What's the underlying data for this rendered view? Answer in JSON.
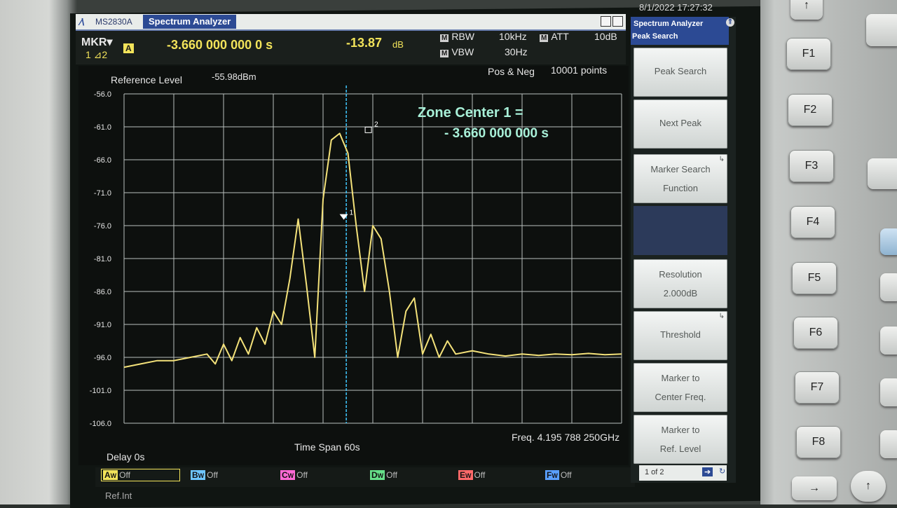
{
  "window": {
    "model": "MS2830A",
    "app_title": "Spectrum Analyzer",
    "datetime": "8/1/2022 17:27:32"
  },
  "marker": {
    "label": "MKR",
    "sub_label": "1 ⊿2",
    "badge": "A",
    "value_time": "-3.660 000 000 0 s",
    "value_db": "-13.87",
    "db_unit": "dB"
  },
  "settings": {
    "rbw_label": "RBW",
    "rbw_value": "10kHz",
    "vbw_label": "VBW",
    "vbw_value": "30Hz",
    "att_label": "ATT",
    "att_value": "10dB",
    "m_badge": "M"
  },
  "graph": {
    "reference_level_label": "Reference Level",
    "reference_level_value": "-55.98dBm",
    "detection": "Pos & Neg",
    "points": "10001 points",
    "zone_center_line1": "Zone Center 1 =",
    "zone_center_line2": "- 3.660 000 000 s",
    "marker1_label": "1",
    "marker2_label": "2",
    "delay": "Delay 0s",
    "time_span": "Time Span 60s",
    "frequency": "Freq. 4.195 788 250GHz"
  },
  "chart_data": {
    "type": "line",
    "ylabel": "",
    "xlabel": "",
    "y_ticks": [
      "-56.0",
      "-61.0",
      "-66.0",
      "-71.0",
      "-76.0",
      "-81.0",
      "-86.0",
      "-91.0",
      "-96.0",
      "-101.0",
      "-106.0"
    ],
    "ylim": [
      -106.0,
      -56.0
    ],
    "xlim": [
      0,
      60
    ],
    "grid": true,
    "trace_color": "#f4e27a",
    "series": [
      {
        "x": [
          0,
          2,
          4,
          6,
          8,
          10,
          11,
          12,
          13,
          14,
          15,
          16,
          17,
          18,
          19,
          20,
          21,
          22,
          23,
          24,
          25,
          26,
          27,
          28,
          29,
          30,
          31,
          32,
          33,
          34,
          35,
          36,
          37,
          38,
          39,
          40,
          42,
          44,
          46,
          48,
          50,
          52,
          54,
          56,
          58,
          60
        ],
        "y": [
          -97.5,
          -97.0,
          -96.5,
          -96.5,
          -96.0,
          -95.5,
          -97.0,
          -94.0,
          -96.5,
          -93.0,
          -95.5,
          -91.5,
          -94.0,
          -89.0,
          -91.0,
          -84.0,
          -75.0,
          -85.0,
          -96.0,
          -72.0,
          -63.0,
          -62.0,
          -65.0,
          -76.0,
          -86.0,
          -76.0,
          -78.0,
          -86.0,
          -96.0,
          -89.0,
          -87.0,
          -95.5,
          -92.5,
          -96.0,
          -93.5,
          -95.5,
          -95.0,
          -95.5,
          -95.8,
          -95.5,
          -95.7,
          -95.5,
          -95.6,
          -95.4,
          -95.6,
          -95.5
        ]
      }
    ],
    "marker_lines": [
      {
        "x": 26.8
      }
    ]
  },
  "softkeys": {
    "header_app": "Spectrum Analyzer",
    "header_func": "Peak Search",
    "items": [
      {
        "line1": "Peak Search",
        "line2": ""
      },
      {
        "line1": "Next Peak",
        "line2": ""
      },
      {
        "line1": "Marker Search",
        "line2": "Function"
      },
      {
        "line1": "Resolution",
        "line2": "2.000dB"
      },
      {
        "line1": "Threshold",
        "line2": ""
      },
      {
        "line1": "Marker to",
        "line2": "Center Freq."
      },
      {
        "line1": "Marker to",
        "line2": "Ref. Level"
      }
    ],
    "page": "1 of 2"
  },
  "traces": [
    {
      "id": "A",
      "letter": "W",
      "state": "Off",
      "color": "#f2e35a"
    },
    {
      "id": "B",
      "letter": "W",
      "state": "Off",
      "color": "#6fc6ff"
    },
    {
      "id": "C",
      "letter": "W",
      "state": "Off",
      "color": "#ff6ad5"
    },
    {
      "id": "D",
      "letter": "W",
      "state": "Off",
      "color": "#66e08a"
    },
    {
      "id": "E",
      "letter": "W",
      "state": "Off",
      "color": "#ff6a6a"
    },
    {
      "id": "F",
      "letter": "W",
      "state": "Off",
      "color": "#5aa0ff"
    }
  ],
  "ref_int": "Ref.Int",
  "hardware_keys": [
    "F1",
    "F2",
    "F3",
    "F4",
    "F5",
    "F6",
    "F7",
    "F8"
  ],
  "nav": {
    "arrow_right": "→",
    "arrow_up": "↑"
  }
}
